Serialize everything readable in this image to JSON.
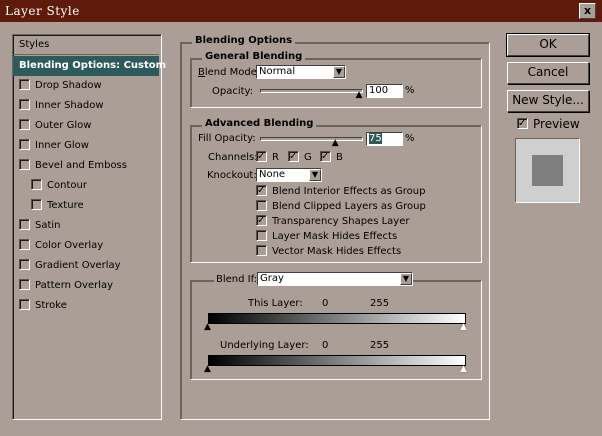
{
  "window": {
    "title": "Layer Style",
    "close_glyph": "x"
  },
  "styles_list": {
    "header": "Styles",
    "items": [
      {
        "label": "Blending Options: Custom",
        "checkbox": false,
        "selected": true,
        "indent": false
      },
      {
        "label": "Drop Shadow",
        "checkbox": true,
        "checked": false,
        "indent": false
      },
      {
        "label": "Inner Shadow",
        "checkbox": true,
        "checked": false,
        "indent": false
      },
      {
        "label": "Outer Glow",
        "checkbox": true,
        "checked": false,
        "indent": false
      },
      {
        "label": "Inner Glow",
        "checkbox": true,
        "checked": false,
        "indent": false
      },
      {
        "label": "Bevel and Emboss",
        "checkbox": true,
        "checked": false,
        "indent": false
      },
      {
        "label": "Contour",
        "checkbox": true,
        "checked": false,
        "indent": true
      },
      {
        "label": "Texture",
        "checkbox": true,
        "checked": false,
        "indent": true
      },
      {
        "label": "Satin",
        "checkbox": true,
        "checked": false,
        "indent": false
      },
      {
        "label": "Color Overlay",
        "checkbox": true,
        "checked": false,
        "indent": false
      },
      {
        "label": "Gradient Overlay",
        "checkbox": true,
        "checked": false,
        "indent": false
      },
      {
        "label": "Pattern Overlay",
        "checkbox": true,
        "checked": false,
        "indent": false
      },
      {
        "label": "Stroke",
        "checkbox": true,
        "checked": false,
        "indent": false
      }
    ]
  },
  "blending_options": {
    "title": "Blending Options",
    "general": {
      "title": "General Blending",
      "blend_mode_label": "Blend Mode:",
      "blend_mode_value": "Normal",
      "opacity_label": "Opacity:",
      "opacity_value": "100",
      "opacity_unit": "%",
      "opacity_fraction": 1.0
    },
    "advanced": {
      "title": "Advanced Blending",
      "fill_opacity_label": "Fill Opacity:",
      "fill_opacity_value": "75",
      "fill_opacity_unit": "%",
      "fill_opacity_fraction": 0.75,
      "channels_label": "Channels:",
      "channel_r": "R",
      "channel_g": "G",
      "channel_b": "B",
      "knockout_label": "Knockout:",
      "knockout_value": "None",
      "options": [
        {
          "label": "Blend Interior Effects as Group",
          "checked": true
        },
        {
          "label": "Blend Clipped Layers as Group",
          "checked": false
        },
        {
          "label": "Transparency Shapes Layer",
          "checked": true
        },
        {
          "label": "Layer Mask Hides Effects",
          "checked": false
        },
        {
          "label": "Vector Mask Hides Effects",
          "checked": false
        }
      ]
    },
    "blend_if": {
      "label": "Blend If:",
      "value": "Gray",
      "this_layer_label": "This Layer:",
      "this_layer_min": "0",
      "this_layer_max": "255",
      "underlying_label": "Underlying Layer:",
      "underlying_min": "0",
      "underlying_max": "255"
    }
  },
  "buttons": {
    "ok": "OK",
    "cancel": "Cancel",
    "new_style": "New Style...",
    "preview_label": "Preview",
    "preview_checked": true
  },
  "colors": {
    "dialog_bg": "#ab9e96",
    "titlebar": "#5e1b0c",
    "selection": "#2d5a5a",
    "preview_swatch": "#7e7e7e",
    "preview_bg": "#cfcfcf"
  }
}
